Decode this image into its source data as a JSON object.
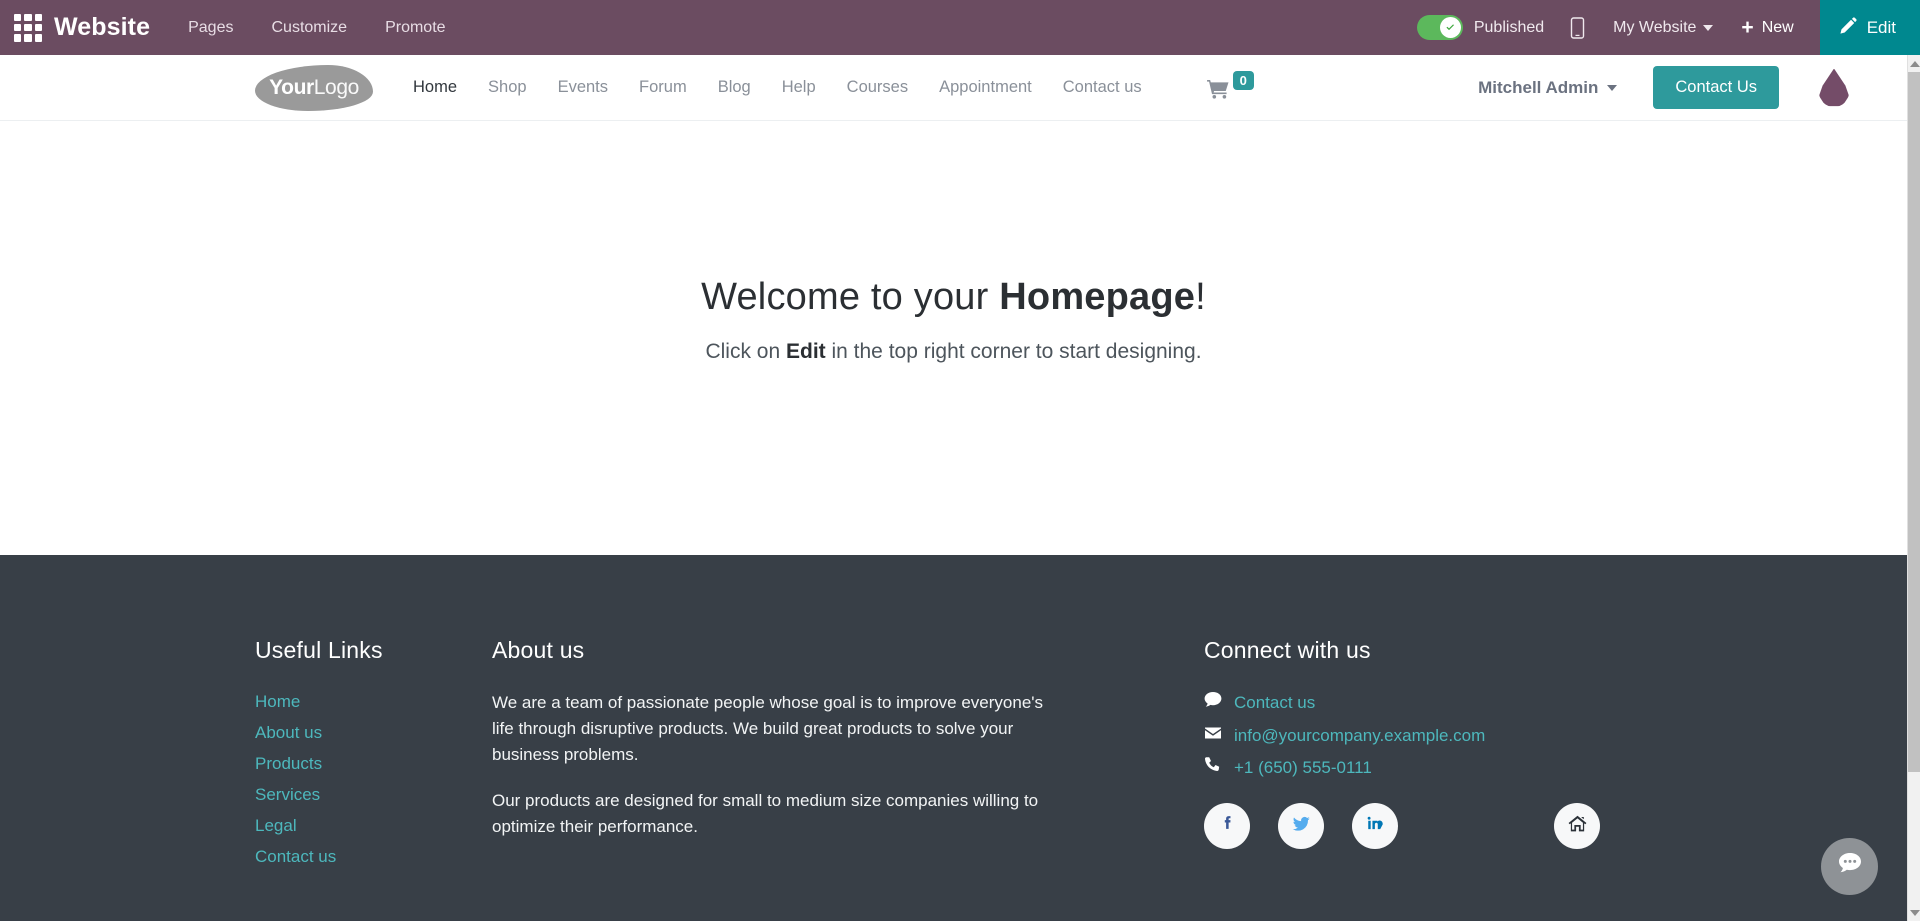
{
  "backend_topbar": {
    "apps_icon": "apps-grid-icon",
    "app_name": "Website",
    "menus": [
      {
        "label": "Pages"
      },
      {
        "label": "Customize"
      },
      {
        "label": "Promote"
      }
    ],
    "publish_toggle": {
      "state_label": "Published",
      "is_on": true,
      "on_color": "#5cb85c",
      "check_icon": "check-icon"
    },
    "mobile_preview_icon": "mobile-icon",
    "website_selector": {
      "label": "My Website",
      "caret_icon": "chevron-down-icon"
    },
    "new_button": {
      "label": "New",
      "icon": "plus-icon"
    },
    "edit_button": {
      "label": "Edit",
      "icon": "pencil-icon",
      "bg": "#00888f"
    },
    "bg_color": "#6b4c61"
  },
  "site_nav": {
    "logo": {
      "text_bold": "Your",
      "text_light": "Logo",
      "name": "your-logo"
    },
    "links": [
      {
        "label": "Home",
        "active": true
      },
      {
        "label": "Shop",
        "active": false
      },
      {
        "label": "Events",
        "active": false
      },
      {
        "label": "Forum",
        "active": false
      },
      {
        "label": "Blog",
        "active": false
      },
      {
        "label": "Help",
        "active": false
      },
      {
        "label": "Courses",
        "active": false
      },
      {
        "label": "Appointment",
        "active": false
      },
      {
        "label": "Contact us",
        "active": false
      }
    ],
    "cart": {
      "icon": "shopping-cart-icon",
      "count": "0",
      "badge_color": "#2e9a9c"
    },
    "user": {
      "name": "Mitchell Admin",
      "caret_icon": "chevron-down-icon"
    },
    "cta": {
      "label": "Contact Us",
      "bg": "#2e9a9c"
    },
    "avatar_drop": {
      "name": "water-drop-avatar",
      "color": "#744c68"
    }
  },
  "hero": {
    "title_prefix": "Welcome to your ",
    "title_bold": "Homepage",
    "title_suffix": "!",
    "sub_prefix": "Click on ",
    "sub_bold": "Edit",
    "sub_suffix": " in the top right corner to start designing."
  },
  "footer": {
    "bg": "#383f47",
    "link_color": "#4db8bd",
    "useful_links": {
      "heading": "Useful Links",
      "items": [
        {
          "label": "Home"
        },
        {
          "label": "About us"
        },
        {
          "label": "Products"
        },
        {
          "label": "Services"
        },
        {
          "label": "Legal"
        },
        {
          "label": "Contact us"
        }
      ]
    },
    "about": {
      "heading": "About us",
      "paragraph_1": "We are a team of passionate people whose goal is to improve everyone's life through disruptive products. We build great products to solve your business problems.",
      "paragraph_2": "Our products are designed for small to medium size companies willing to optimize their performance."
    },
    "connect": {
      "heading": "Connect with us",
      "rows": [
        {
          "icon": "comment-icon",
          "label": "Contact us"
        },
        {
          "icon": "envelope-icon",
          "label": "info@yourcompany.example.com"
        },
        {
          "icon": "phone-icon",
          "label": "+1 (650) 555-0111"
        }
      ],
      "socials": [
        {
          "icon": "facebook-icon",
          "name": "facebook"
        },
        {
          "icon": "twitter-icon",
          "name": "twitter"
        },
        {
          "icon": "linkedin-icon",
          "name": "linkedin"
        },
        {
          "icon": "home-icon",
          "name": "home"
        }
      ]
    }
  },
  "chat_widget": {
    "icon": "chat-bubble-icon",
    "bg": "#8e9296"
  },
  "scrollbar": {
    "up_icon": "scroll-up-arrow",
    "down_icon": "scroll-down-arrow"
  }
}
